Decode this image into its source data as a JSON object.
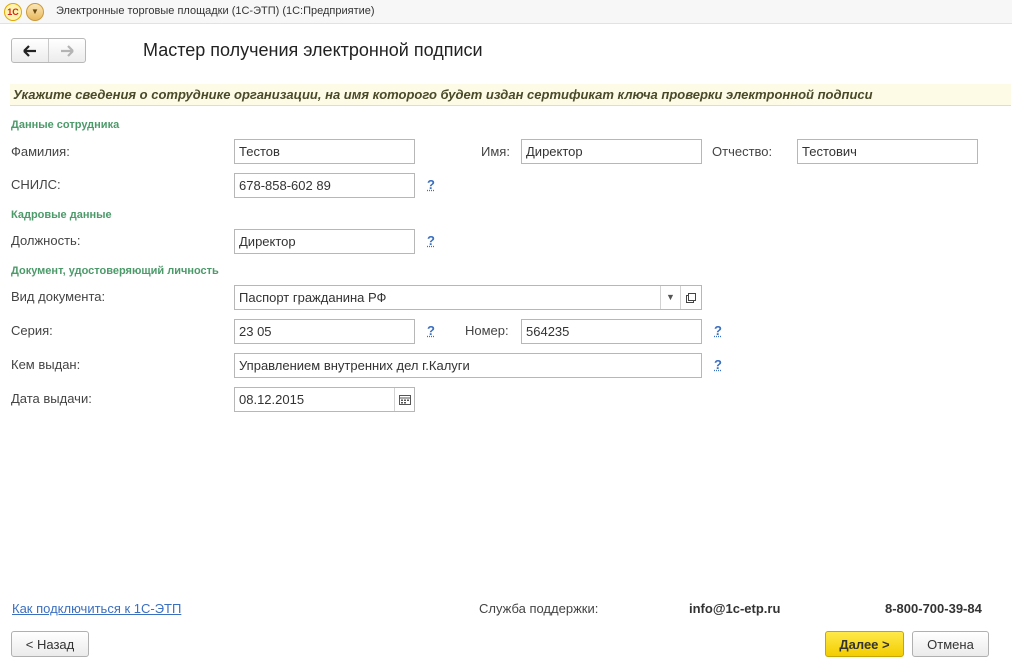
{
  "window": {
    "logo_text": "1С",
    "title": "Электронные торговые площадки (1С-ЭТП)  (1С:Предприятие)"
  },
  "nav": {
    "back_icon": "arrow-left-icon",
    "forward_icon": "arrow-right-icon"
  },
  "page": {
    "title": "Мастер получения электронной подписи",
    "instruction": "Укажите сведения о сотруднике организации, на имя которого будет издан сертификат ключа проверки электронной подписи"
  },
  "sections": {
    "employee": "Данные сотрудника",
    "hr": "Кадровые данные",
    "document": "Документ, удостоверяющий личность"
  },
  "fields": {
    "last_name": {
      "label": "Фамилия:",
      "value": "Тестов"
    },
    "first_name": {
      "label": "Имя:",
      "value": "Директор"
    },
    "middle_name": {
      "label": "Отчество:",
      "value": "Тестович"
    },
    "snils": {
      "label": "СНИЛС:",
      "value": "678-858-602 89"
    },
    "position": {
      "label": "Должность:",
      "value": "Директор"
    },
    "doc_type": {
      "label": "Вид документа:",
      "value": "Паспорт гражданина РФ"
    },
    "series": {
      "label": "Серия:",
      "value": "23 05"
    },
    "number": {
      "label": "Номер:",
      "value": "564235"
    },
    "issued_by": {
      "label": "Кем выдан:",
      "value": "Управлением внутренних дел г.Калуги"
    },
    "issue_date": {
      "label": "Дата выдачи:",
      "value": "08.12.2015"
    }
  },
  "help_mark": "?",
  "footer": {
    "connect_link": "Как подключиться к 1С-ЭТП",
    "support_label": "Служба поддержки:",
    "email": "info@1c-etp.ru",
    "phone": "8-800-700-39-84"
  },
  "buttons": {
    "back": "< Назад",
    "next": "Далее >",
    "cancel": "Отмена"
  },
  "colors": {
    "section_green": "#4c9a6a",
    "link_blue": "#3b6fc0",
    "primary_yellow": "#f3cd00",
    "banner_bg": "#fdfbe6"
  }
}
